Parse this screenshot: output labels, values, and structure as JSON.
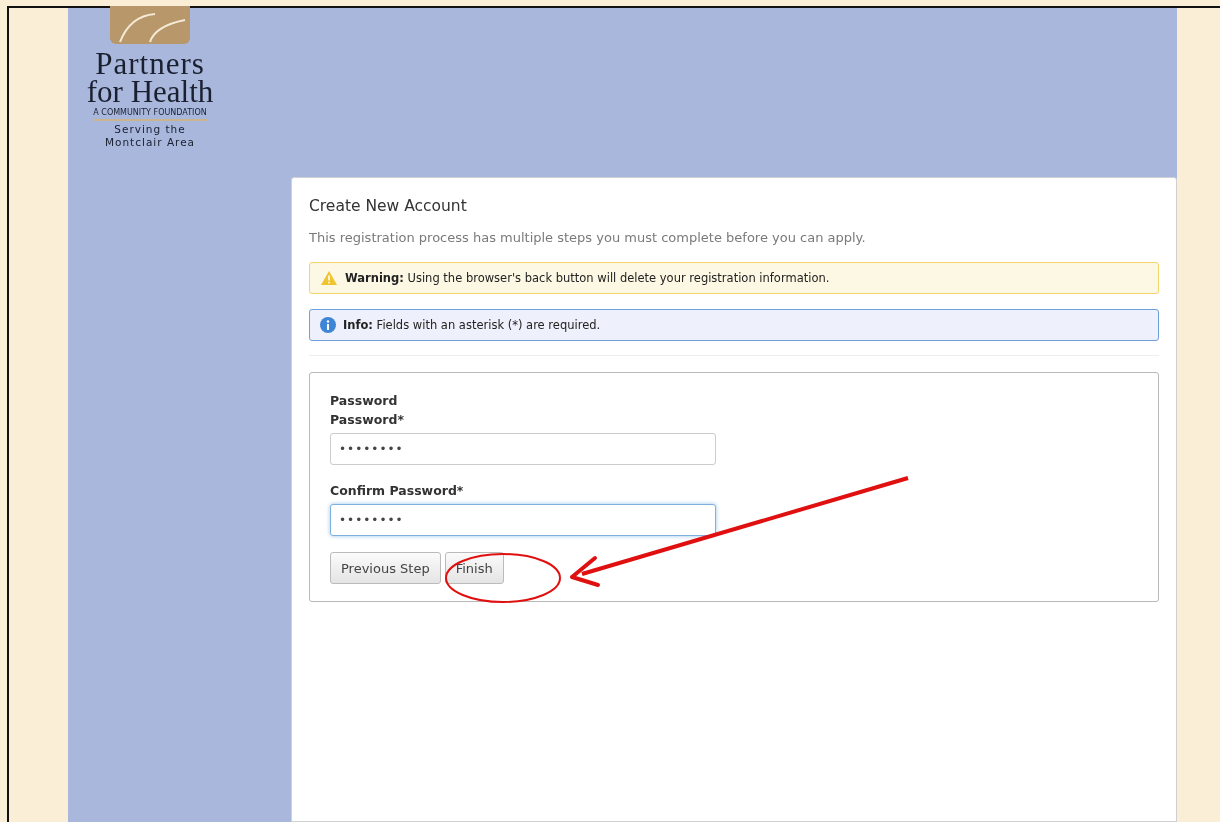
{
  "logo": {
    "name_line1": "Partners",
    "name_line2": "for Health",
    "subtitle": "A COMMUNITY FOUNDATION",
    "tagline_line1": "Serving the",
    "tagline_line2": "Montclair Area"
  },
  "form": {
    "title": "Create New Account",
    "intro": "This registration process has multiple steps you must complete before you can apply.",
    "alerts": [
      {
        "kind": "warning",
        "text": "**Warning:** Using the browser's back button will delete your registration information."
      },
      {
        "kind": "info",
        "text": "**Info:** Fields with an asterisk (*) are required."
      }
    ],
    "section_label": "Password",
    "fields": [
      {
        "label": "Password*",
        "value": "••••••••",
        "focused": false
      },
      {
        "label": "Confirm Password*",
        "value": "••••••••",
        "focused": true
      }
    ],
    "buttons": [
      "Previous Step",
      "Finish"
    ]
  },
  "annotations": {
    "arrow": true,
    "circle": true
  }
}
